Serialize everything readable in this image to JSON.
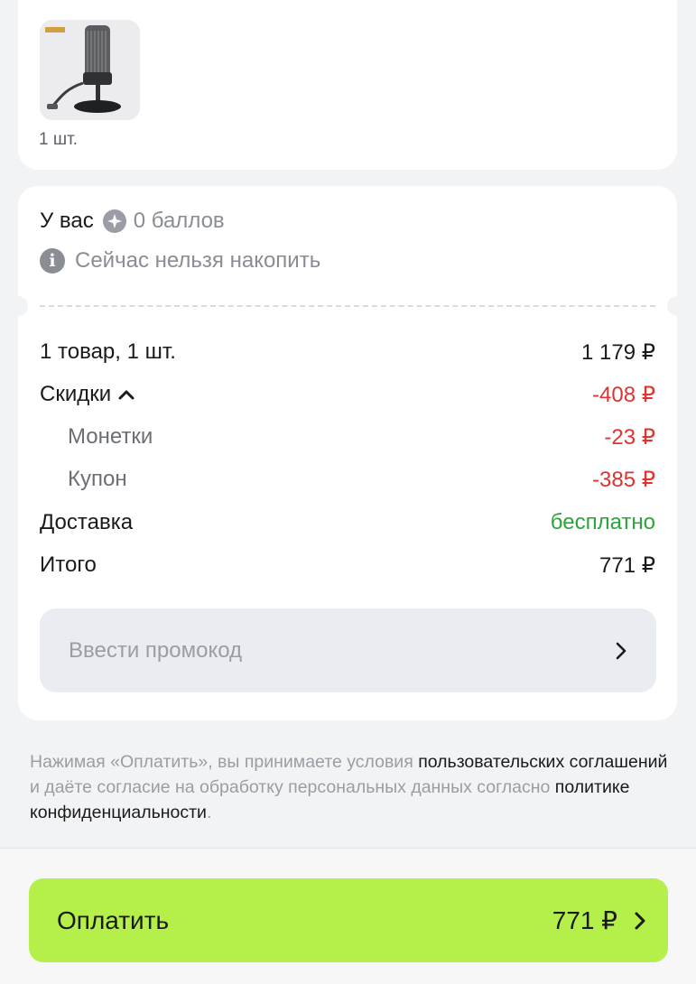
{
  "product": {
    "quantity": "1 шт.",
    "image_icon": "microphone-product-image"
  },
  "points": {
    "lead": "У вас",
    "value": "0 баллов",
    "info": "Сейчас нельзя накопить"
  },
  "summary": {
    "items_label": "1 товар, 1 шт.",
    "items_price": "1 179 ₽",
    "discounts_label": "Скидки",
    "discounts_value": "-408 ₽",
    "coins_label": "Монетки",
    "coins_value": "-23 ₽",
    "coupon_label": "Купон",
    "coupon_value": "-385 ₽",
    "delivery_label": "Доставка",
    "delivery_value": "бесплатно",
    "total_label": "Итого",
    "total_value": "771 ₽"
  },
  "promo": {
    "placeholder": "Ввести промокод"
  },
  "legal": {
    "part1": "Нажимая «Оплатить», вы принимаете условия ",
    "link1": "пользовательских соглашений",
    "part2": " и даёте согласие на обработку персональных данных согласно ",
    "link2": "политике конфиденциальности",
    "part3": "."
  },
  "pay": {
    "label": "Оплатить",
    "amount": "771 ₽"
  },
  "colors": {
    "accent": "#b5ef4a",
    "discount": "#e0322f",
    "free": "#2aa53a"
  }
}
